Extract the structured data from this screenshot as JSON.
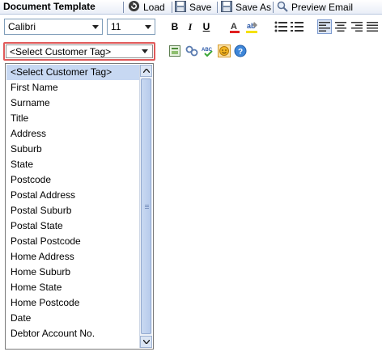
{
  "toolbar": {
    "title": "Document Template",
    "load_label": "Load",
    "save_label": "Save",
    "save_as_label": "Save As",
    "preview_label": "Preview Email"
  },
  "format": {
    "font_family": "Calibri",
    "font_size": "11",
    "bold_label": "B",
    "italic_label": "I",
    "underline_label": "U"
  },
  "customer_tag": {
    "selected": "<Select Customer Tag>",
    "options": [
      "<Select Customer Tag>",
      "First Name",
      "Surname",
      "Title",
      "Address",
      "Suburb",
      "State",
      "Postcode",
      "Postal Address",
      "Postal Suburb",
      "Postal State",
      "Postal Postcode",
      "Home Address",
      "Home Suburb",
      "Home State",
      "Home Postcode",
      "Date",
      "Debtor Account No."
    ]
  },
  "icons": {
    "load": "refresh-icon",
    "save": "floppy-disk-icon",
    "save_as": "floppy-disk-icon",
    "preview": "magnifier-icon",
    "font_color": "font-color-icon",
    "highlight": "highlight-icon",
    "bullets": "bullet-list-icon",
    "numbering": "numbered-list-icon",
    "align_left": "align-left-icon",
    "align_center": "align-center-icon",
    "align_right": "align-right-icon",
    "justify": "justify-icon",
    "insert_image": "image-icon",
    "insert_link": "link-icon",
    "spellcheck": "spellcheck-icon",
    "emoticon": "smiley-icon",
    "help": "help-icon"
  },
  "colors": {
    "highlight_border": "#e05a5a",
    "selection": "#c7d8f2",
    "font_color_bar": "#e02020",
    "highlight_bar": "#f5e100"
  }
}
